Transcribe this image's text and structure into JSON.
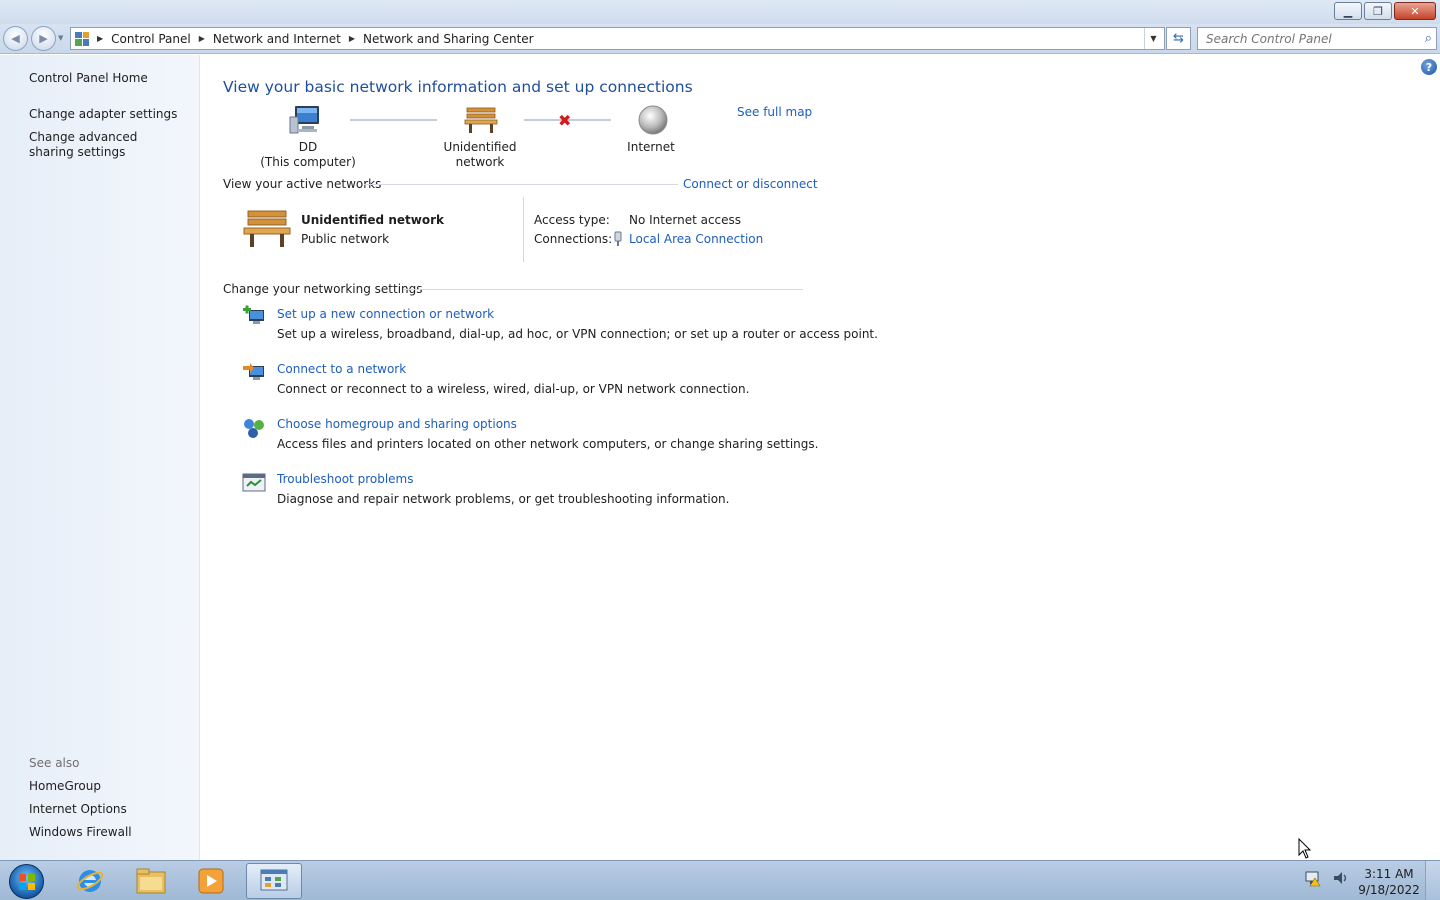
{
  "window": {
    "minimize_label": "▁",
    "restore_label": "❐",
    "close_label": "✕"
  },
  "address_bar": {
    "breadcrumbs": [
      "Control Panel",
      "Network and Internet",
      "Network and Sharing Center"
    ]
  },
  "search": {
    "placeholder": "Search Control Panel"
  },
  "sidebar": {
    "items": [
      {
        "label": "Control Panel Home"
      },
      {
        "label": "Change adapter settings"
      },
      {
        "label": "Change advanced sharing settings"
      }
    ],
    "see_also_label": "See also",
    "see_also": [
      {
        "label": "HomeGroup"
      },
      {
        "label": "Internet Options"
      },
      {
        "label": "Windows Firewall"
      }
    ]
  },
  "main": {
    "heading": "View your basic network information and set up connections",
    "see_full_map": "See full map",
    "map": {
      "computer_name": "DD",
      "computer_sub": "(This computer)",
      "network_name": "Unidentified network",
      "internet_label": "Internet"
    },
    "active_networks": {
      "title": "View your active networks",
      "connect_link": "Connect or disconnect",
      "network_name": "Unidentified network",
      "network_type": "Public network",
      "access_type_label": "Access type:",
      "access_type_value": "No Internet access",
      "connections_label": "Connections:",
      "connections_value": "Local Area Connection"
    },
    "settings": {
      "title": "Change your networking settings",
      "tasks": [
        {
          "link": "Set up a new connection or network",
          "desc": "Set up a wireless, broadband, dial-up, ad hoc, or VPN connection; or set up a router or access point."
        },
        {
          "link": "Connect to a network",
          "desc": "Connect or reconnect to a wireless, wired, dial-up, or VPN network connection."
        },
        {
          "link": "Choose homegroup and sharing options",
          "desc": "Access files and printers located on other network computers, or change sharing settings."
        },
        {
          "link": "Troubleshoot problems",
          "desc": "Diagnose and repair network problems, or get troubleshooting information."
        }
      ]
    }
  },
  "taskbar": {
    "time": "3:11 AM",
    "date": "9/18/2022"
  },
  "colors": {
    "link": "#1e5dbd",
    "heading": "#1e4f9c"
  }
}
